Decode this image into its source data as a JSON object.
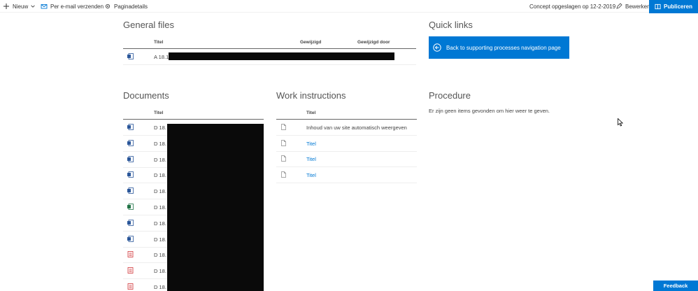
{
  "toolbar": {
    "new_label": "Nieuw",
    "email_label": "Per e-mail verzenden",
    "details_label": "Paginadetails",
    "status": "Concept opgeslagen op 12-2-2019",
    "edit_label": "Bewerken",
    "publish_label": "Publiceren"
  },
  "general_files": {
    "title": "General files",
    "headers": {
      "title": "Titel",
      "modified": "Gewijzigd",
      "modified_by": "Gewijzigd door"
    },
    "rows": [
      {
        "name": "A 18.1",
        "icon": "word-doc-icon"
      }
    ]
  },
  "quick_links": {
    "title": "Quick links",
    "button_label": "Back to supporting processes navigation page"
  },
  "documents": {
    "title": "Documents",
    "header_title": "Titel",
    "rows": [
      {
        "name": "D 18.",
        "icon": "word-doc-icon"
      },
      {
        "name": "D 18.",
        "icon": "word-doc-icon"
      },
      {
        "name": "D 18.",
        "icon": "word-doc-icon"
      },
      {
        "name": "D 18.",
        "icon": "word-doc-icon"
      },
      {
        "name": "D 18.",
        "icon": "word-doc-icon"
      },
      {
        "name": "D 18.",
        "icon": "excel-doc-icon"
      },
      {
        "name": "D 18.",
        "icon": "word-doc-icon"
      },
      {
        "name": "D 18.",
        "icon": "word-doc-icon"
      },
      {
        "name": "D 18.",
        "icon": "pdf-doc-icon"
      },
      {
        "name": "D 18.",
        "icon": "pdf-doc-icon"
      },
      {
        "name": "D 18.",
        "icon": "pdf-doc-icon"
      }
    ]
  },
  "work_instructions": {
    "title": "Work instructions",
    "header_title": "Titel",
    "rows": [
      {
        "name": "Inhoud van uw site automatisch weergeven",
        "link": false
      },
      {
        "name": "Titel",
        "link": true
      },
      {
        "name": "Titel",
        "link": true
      },
      {
        "name": "Titel",
        "link": true
      }
    ]
  },
  "procedure": {
    "title": "Procedure",
    "empty_message": "Er zijn geen items gevonden om hier weer te geven."
  },
  "feedback_label": "Feedback",
  "colors": {
    "accent": "#0078d4",
    "word": "#2b579a",
    "excel": "#217346",
    "pdf": "#d13438"
  }
}
